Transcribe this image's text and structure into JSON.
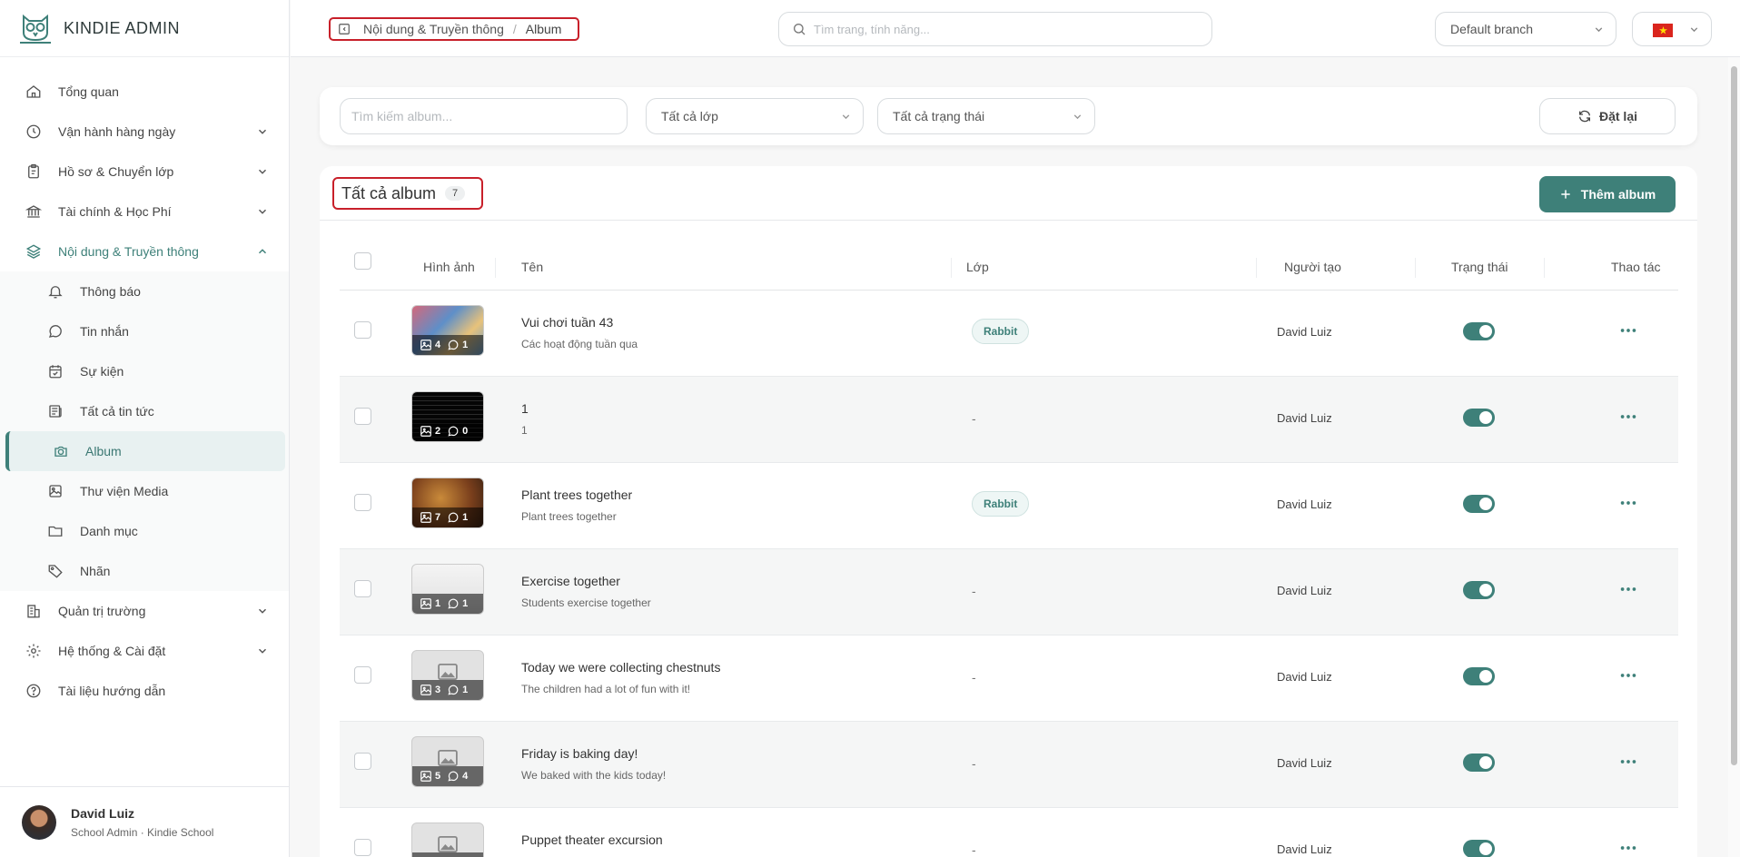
{
  "brand": {
    "name": "KINDIE ADMIN"
  },
  "sidebar": {
    "items": [
      {
        "label": "Tổng quan",
        "icon": "home-icon"
      },
      {
        "label": "Vận hành hàng ngày",
        "icon": "clock-icon"
      },
      {
        "label": "Hồ sơ & Chuyển lớp",
        "icon": "clipboard-icon"
      },
      {
        "label": "Tài chính & Học Phí",
        "icon": "bank-icon"
      },
      {
        "label": "Nội dung & Truyền thông",
        "icon": "layers-icon",
        "expanded": true
      },
      {
        "label": "Quản trị trường",
        "icon": "building-icon"
      },
      {
        "label": "Hệ thống & Cài đặt",
        "icon": "gear-icon"
      },
      {
        "label": "Tài liệu hướng dẫn",
        "icon": "help-circle-icon"
      }
    ],
    "sub_items": [
      {
        "label": "Thông báo",
        "icon": "bell-icon"
      },
      {
        "label": "Tin nhắn",
        "icon": "chat-icon"
      },
      {
        "label": "Sự kiện",
        "icon": "calendar-check-icon"
      },
      {
        "label": "Tất cả tin tức",
        "icon": "newspaper-icon"
      },
      {
        "label": "Album",
        "icon": "camera-icon",
        "active": true
      },
      {
        "label": "Thư viện Media",
        "icon": "image-icon"
      },
      {
        "label": "Danh mục",
        "icon": "folder-icon"
      },
      {
        "label": "Nhãn",
        "icon": "tag-icon"
      }
    ]
  },
  "user": {
    "name": "David Luiz",
    "role": "School Admin · Kindie School"
  },
  "header": {
    "breadcrumb": {
      "parent": "Nội dung & Truyền thông",
      "separator": "/",
      "current": "Album"
    },
    "search_placeholder": "Tìm trang, tính năng...",
    "branch": "Default branch",
    "language_flag": "vietnam-flag-icon"
  },
  "filters": {
    "search_placeholder": "Tìm kiếm album...",
    "class_select": "Tất cả lớp",
    "status_select": "Tất cả trạng thái",
    "reset_label": "Đặt lại"
  },
  "albums": {
    "title": "Tất cả album",
    "count": "7",
    "add_label": "Thêm album",
    "columns": {
      "image": "Hình ảnh",
      "name": "Tên",
      "class": "Lớp",
      "creator": "Người tạo",
      "status": "Trạng thái",
      "actions": "Thao tác"
    },
    "rows": [
      {
        "name": "Vui chơi tuần 43",
        "desc": "Các hoạt động tuần qua",
        "class": "Rabbit",
        "creator": "David Luiz",
        "photos": "4",
        "comments": "1",
        "active": true
      },
      {
        "name": "1",
        "desc": "1",
        "class": "-",
        "creator": "David Luiz",
        "photos": "2",
        "comments": "0",
        "active": true
      },
      {
        "name": "Plant trees together",
        "desc": "Plant trees together",
        "class": "Rabbit",
        "creator": "David Luiz",
        "photos": "7",
        "comments": "1",
        "active": true
      },
      {
        "name": "Exercise together",
        "desc": "Students exercise together",
        "class": "-",
        "creator": "David Luiz",
        "photos": "1",
        "comments": "1",
        "active": true
      },
      {
        "name": "Today we were collecting chestnuts",
        "desc": "The children had a lot of fun with it!",
        "class": "-",
        "creator": "David Luiz",
        "photos": "3",
        "comments": "1",
        "active": true
      },
      {
        "name": "Friday is baking day!",
        "desc": "We baked with the kids today!",
        "class": "-",
        "creator": "David Luiz",
        "photos": "5",
        "comments": "4",
        "active": true
      },
      {
        "name": "Puppet theater excursion",
        "desc": "",
        "class": "-",
        "creator": "David Luiz",
        "photos": "",
        "comments": "",
        "active": true
      }
    ]
  },
  "colors": {
    "accent": "#3e8079",
    "highlight_border": "#c8202a"
  }
}
